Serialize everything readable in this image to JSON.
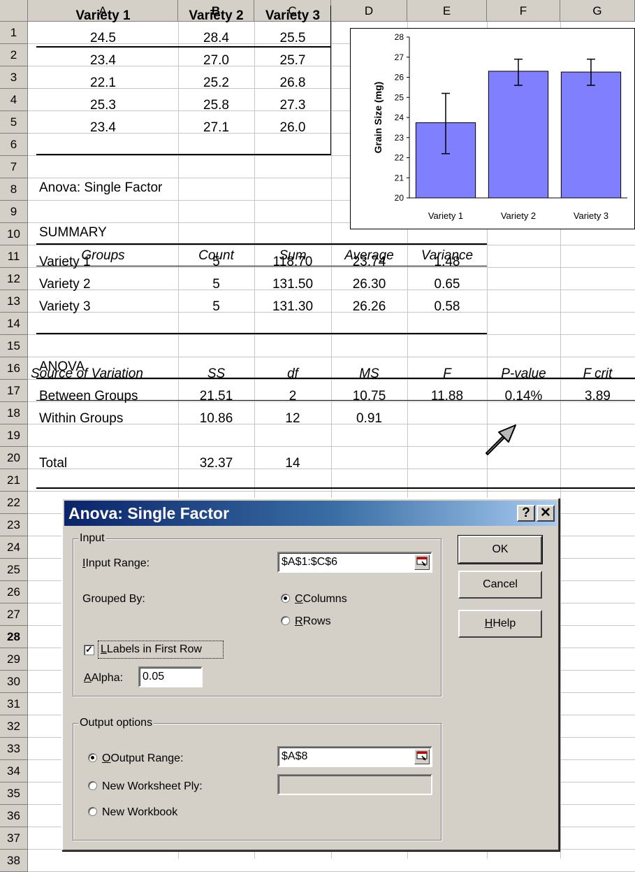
{
  "columns": [
    "A",
    "B",
    "C",
    "D",
    "E",
    "F",
    "G"
  ],
  "rows": [
    "1",
    "2",
    "3",
    "4",
    "5",
    "6",
    "7",
    "8",
    "9",
    "10",
    "11",
    "12",
    "13",
    "14",
    "15",
    "16",
    "17",
    "18",
    "19",
    "20",
    "21",
    "22",
    "23",
    "24",
    "25",
    "26",
    "27",
    "28",
    "29",
    "30",
    "31",
    "32",
    "33",
    "34",
    "35",
    "36",
    "37",
    "38"
  ],
  "data_table": {
    "headers": [
      "Variety 1",
      "Variety 2",
      "Variety 3"
    ],
    "rows": [
      [
        "24.5",
        "28.4",
        "25.5"
      ],
      [
        "23.4",
        "27.0",
        "25.7"
      ],
      [
        "22.1",
        "25.2",
        "26.8"
      ],
      [
        "25.3",
        "25.8",
        "27.3"
      ],
      [
        "23.4",
        "27.1",
        "26.0"
      ]
    ]
  },
  "anova_title": "Anova: Single Factor",
  "summary": {
    "label": "SUMMARY",
    "headers": [
      "Groups",
      "Count",
      "Sum",
      "Average",
      "Variance"
    ],
    "rows": [
      [
        "Variety 1",
        "5",
        "118.70",
        "23.74",
        "1.48"
      ],
      [
        "Variety 2",
        "5",
        "131.50",
        "26.30",
        "0.65"
      ],
      [
        "Variety 3",
        "5",
        "131.30",
        "26.26",
        "0.58"
      ]
    ]
  },
  "anova": {
    "label": "ANOVA",
    "headers": [
      "Source of Variation",
      "SS",
      "df",
      "MS",
      "F",
      "P-value",
      "F crit"
    ],
    "between": [
      "Between Groups",
      "21.51",
      "2",
      "10.75",
      "11.88",
      "0.14%",
      "3.89"
    ],
    "within": [
      "Within Groups",
      "10.86",
      "12",
      "0.91"
    ],
    "total": [
      "Total",
      "32.37",
      "14"
    ]
  },
  "chart_data": {
    "type": "bar",
    "categories": [
      "Variety 1",
      "Variety 2",
      "Variety 3"
    ],
    "values": [
      23.74,
      26.3,
      26.26
    ],
    "error_low": [
      22.2,
      25.6,
      25.6
    ],
    "error_high": [
      25.2,
      26.9,
      26.9
    ],
    "ylabel": "Grain Size (mg)",
    "ylim": [
      20,
      28
    ],
    "yticks": [
      "20",
      "21",
      "22",
      "23",
      "24",
      "25",
      "26",
      "27",
      "28"
    ],
    "bar_color": "#8080ff",
    "grid": false,
    "legend": "none"
  },
  "dialog": {
    "title": "Anova: Single Factor",
    "help_btn": "?",
    "close_btn": "✕",
    "input_group": "Input",
    "input_range_label": "Input Range:",
    "input_range_value": "$A$1:$C$6",
    "grouped_by_label": "Grouped By:",
    "columns_option": "Columns",
    "rows_option": "Rows",
    "labels_checkbox": "Labels in First Row",
    "alpha_label": "Alpha:",
    "alpha_value": "0.05",
    "output_group": "Output options",
    "output_range_label": "Output Range:",
    "output_range_value": "$A$8",
    "new_ply_label": "New Worksheet Ply:",
    "new_workbook_label": "New Workbook",
    "ok": "OK",
    "cancel": "Cancel",
    "help": "Help"
  }
}
